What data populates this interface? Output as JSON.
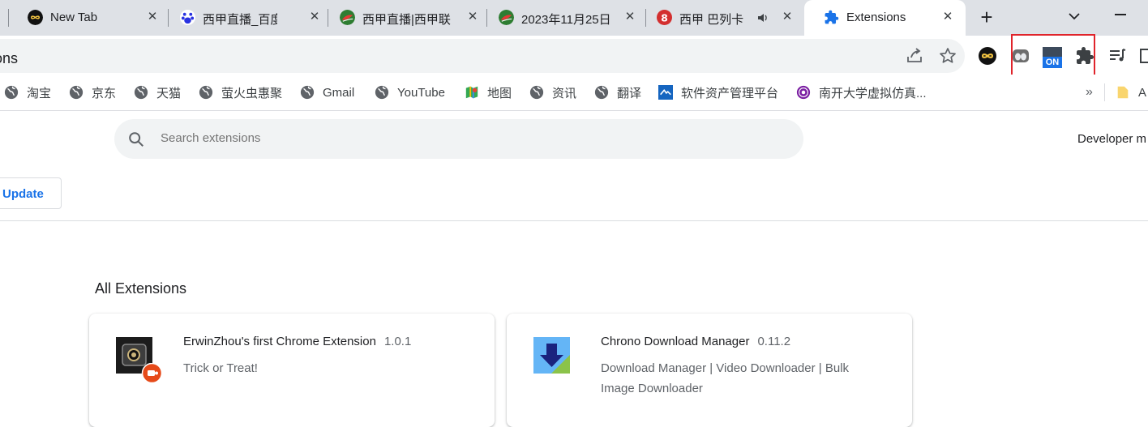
{
  "tabs": [
    {
      "title": "New Tab",
      "icon": "infinity-icon",
      "close": "✕"
    },
    {
      "title": "西甲直播_百度搜",
      "icon": "baidu-icon",
      "close": "✕"
    },
    {
      "title": "西甲直播|西甲联",
      "icon": "leaf-icon",
      "close": "✕"
    },
    {
      "title": "2023年11月25日",
      "icon": "leaf-icon",
      "close": "✕"
    },
    {
      "title": "西甲 巴列卡",
      "icon": "brand-red-icon",
      "close": "✕"
    },
    {
      "title": "Extensions",
      "icon": "puzzle-icon",
      "close": "✕"
    }
  ],
  "tabstrip": {
    "new_tab": "+"
  },
  "toolbar": {
    "url": "sions",
    "on_badge": "ON"
  },
  "bookmarks": [
    {
      "label": "淘宝"
    },
    {
      "label": "京东"
    },
    {
      "label": "天猫"
    },
    {
      "label": "萤火虫惠聚"
    },
    {
      "label": "Gmail"
    },
    {
      "label": "YouTube"
    },
    {
      "label": "地图"
    },
    {
      "label": "资讯"
    },
    {
      "label": "翻译"
    },
    {
      "label": "软件资产管理平台"
    },
    {
      "label": "南开大学虚拟仿真..."
    }
  ],
  "bookmarks_overflow": "»",
  "bookmark_folder": {
    "label": "A"
  },
  "extensions_page": {
    "search_placeholder": "Search extensions",
    "developer_mode_label": "Developer m",
    "update_button": "Update",
    "section_title": "All Extensions",
    "extensions": [
      {
        "name": "ErwinZhou's first Chrome Extension",
        "version": "1.0.1",
        "description": "Trick or Treat!"
      },
      {
        "name": "Chrono Download Manager",
        "version": "0.11.2",
        "description": "Download Manager | Video Downloader | Bulk Image Downloader"
      }
    ]
  },
  "colors": {
    "accent": "#1a73e8",
    "highlight_border": "#e0242b",
    "tabstrip_bg": "#dee1e6"
  }
}
